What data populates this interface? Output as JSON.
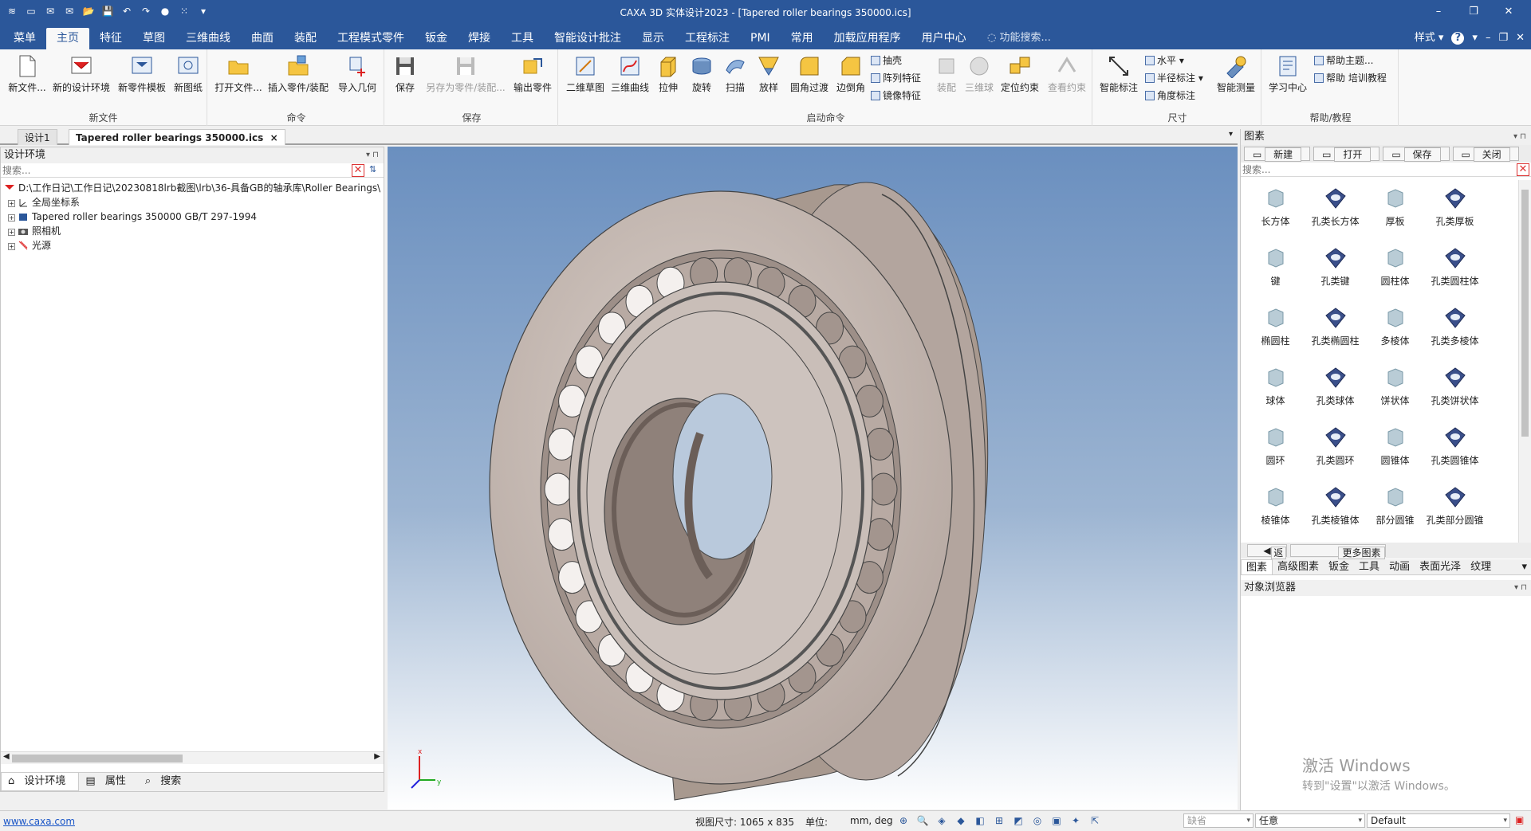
{
  "titlebar": {
    "title": "CAXA 3D 实体设计2023 - [Tapered roller bearings 350000.ics]",
    "quick_access": [
      "≋",
      "▭",
      "✉",
      "✉",
      "📂",
      "💾",
      "↶",
      "↷",
      "●",
      "⁙",
      "▾"
    ],
    "window_buttons": [
      "–",
      "❐",
      "✕"
    ]
  },
  "menubar": {
    "tabs": [
      "菜单",
      "主页",
      "特征",
      "草图",
      "三维曲线",
      "曲面",
      "装配",
      "工程模式零件",
      "钣金",
      "焊接",
      "工具",
      "智能设计批注",
      "显示",
      "工程标注",
      "PMI",
      "常用",
      "加载应用程序",
      "用户中心"
    ],
    "active_tab": "主页",
    "search_placeholder": "功能搜索...",
    "style_label": "样式",
    "style_arrow": "▾",
    "help_icon": "?",
    "right_icons": [
      "▾",
      "–",
      "❐",
      "✕"
    ]
  },
  "ribbon": {
    "groups": {
      "new_file": "新文件",
      "command": "命令",
      "save": "保存",
      "launch": "启动命令",
      "dimension": "尺寸",
      "help": "帮助/教程"
    },
    "buttons": {
      "new_file": "新文件...",
      "new_design_env": "新的设计环境",
      "new_part_template": "新零件模板",
      "new_drawing": "新图纸",
      "open_file": "打开文件...",
      "insert_part": "插入零件/装配",
      "import_geometry": "导入几何",
      "save": "保存",
      "save_as_part": "另存为零件/装配...",
      "export_part": "输出零件",
      "sketch_2d": "二维草图",
      "curve_3d": "三维曲线",
      "extrude": "拉伸",
      "revolve": "旋转",
      "sweep": "扫描",
      "loft": "放样",
      "fillet": "圆角过渡",
      "chamfer": "边倒角",
      "assembly": "装配",
      "sphere_3d": "三维球",
      "locate_constraint": "定位约束",
      "view_constraint": "查看约束",
      "smart_dimension": "智能标注",
      "smart_measure": "智能测量",
      "learning_center": "学习中心"
    },
    "small_buttons": {
      "shell": "抽壳",
      "array": "阵列特征",
      "mirror": "镜像特征",
      "horizontal": "水平",
      "radius_dim": "半径标注",
      "angle_dim": "角度标注",
      "help_topics": "帮助主题...",
      "help_training": "帮助 培训教程"
    }
  },
  "doctabs": {
    "tabs": [
      "设计1",
      "Tapered roller bearings 350000.ics"
    ],
    "active": "Tapered roller bearings 350000.ics",
    "close_symbol": "×",
    "overflow_symbol": "▾"
  },
  "leftpanel": {
    "title": "设计环境",
    "pin_controls": "▾  ⊓",
    "search_placeholder": "搜索...",
    "clear_symbol": "✕",
    "tree": [
      {
        "label": "D:\\工作日记\\工作日记\\20230818lrb截图\\lrb\\36-具备GB的轴承库\\Roller Bearings\\",
        "expander": ""
      },
      {
        "label": "全局坐标系",
        "expander": "+"
      },
      {
        "label": "Tapered roller bearings 350000 GB/T 297-1994",
        "expander": "+"
      },
      {
        "label": "照相机",
        "expander": "+"
      },
      {
        "label": "光源",
        "expander": "+"
      }
    ],
    "bottom_tabs": [
      "设计环境",
      "属性",
      "搜索"
    ],
    "scroll_left": "◀",
    "scroll_right": "▶"
  },
  "viewport": {
    "axis_x": "x",
    "axis_y": "y"
  },
  "rightpanel": {
    "title": "图素",
    "pin_controls": "▾  ⊓",
    "toolbar": [
      "新建",
      "打开",
      "保存",
      "关闭"
    ],
    "search_placeholder": "搜索...",
    "clear_symbol": "✕",
    "items": [
      "长方体",
      "孔类长方体",
      "厚板",
      "孔类厚板",
      "键",
      "孔类键",
      "圆柱体",
      "孔类圆柱体",
      "椭圆柱",
      "孔类椭圆柱",
      "多棱体",
      "孔类多棱体",
      "球体",
      "孔类球体",
      "饼状体",
      "孔类饼状体",
      "圆环",
      "孔类圆环",
      "圆锥体",
      "孔类圆锥体",
      "棱锥体",
      "孔类棱锥体",
      "部分圆锥",
      "孔类部分圆锥"
    ],
    "back_label": "返回",
    "more_label": "更多图素库",
    "catalog_tabs": [
      "图素",
      "高级图素",
      "钣金",
      "工具",
      "动画",
      "表面光泽",
      "纹理"
    ],
    "catalog_overflow": "▾",
    "object_browser_title": "对象浏览器",
    "watermark_line1": "激活 Windows",
    "watermark_line2": "转到\"设置\"以激活 Windows。"
  },
  "statusbar": {
    "website": "www.caxa.com",
    "view_size": "视图尺寸: 1065 x  835",
    "unit_label": "单位:",
    "unit_value": "mm, deg",
    "tool_icons": [
      "⊕",
      "🔍",
      "◈",
      "◆",
      "◧",
      "⊞",
      "◩",
      "◎",
      "▣",
      "✦",
      "⇱"
    ],
    "combo_default": "缺省",
    "combo_any": "任意",
    "combo_style": "Default",
    "combo_arrow": "▾"
  }
}
